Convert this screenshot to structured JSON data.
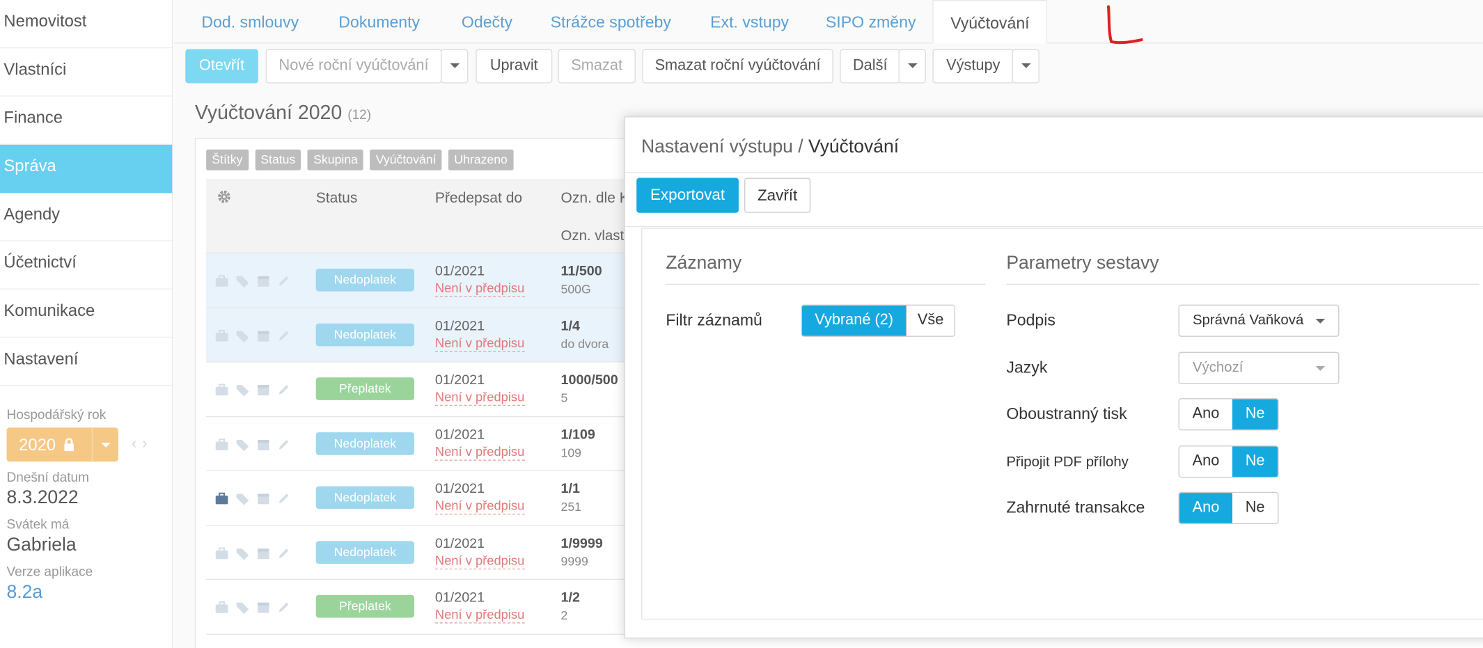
{
  "sidebar": {
    "items": [
      {
        "label": "Nemovitost",
        "active": false
      },
      {
        "label": "Vlastníci",
        "active": false
      },
      {
        "label": "Finance",
        "active": false
      },
      {
        "label": "Správa",
        "active": true
      },
      {
        "label": "Agendy",
        "active": false
      },
      {
        "label": "Účetnictví",
        "active": false
      },
      {
        "label": "Komunikace",
        "active": false
      },
      {
        "label": "Nastavení",
        "active": false
      }
    ],
    "fiscal_year_label": "Hospodářský rok",
    "fiscal_year": "2020",
    "today_label": "Dnešní datum",
    "today": "8.3.2022",
    "nameday_label": "Svátek má",
    "nameday": "Gabriela",
    "version_label": "Verze aplikace",
    "version": "8.2a"
  },
  "tabs": [
    "Dod. smlouvy",
    "Dokumenty",
    "Odečty",
    "Strážce spotřeby",
    "Ext. vstupy",
    "SIPO změny",
    "Vyúčtování"
  ],
  "active_tab": "Vyúčtování",
  "toolbar": {
    "open": "Otevřít",
    "new_annual": "Nové roční vyúčtování",
    "edit": "Upravit",
    "delete": "Smazat",
    "delete_annual": "Smazat roční vyúčtování",
    "more": "Další",
    "outputs": "Výstupy"
  },
  "page": {
    "title": "Vyúčtování 2020",
    "count": "(12)"
  },
  "filters": [
    "Štítky",
    "Status",
    "Skupina",
    "Vyúčtování",
    "Uhrazeno"
  ],
  "table": {
    "headers": {
      "status": "Status",
      "due": "Předepsat do",
      "code": "Ozn. dle K",
      "code2": "Ozn. vlast"
    },
    "rows": [
      {
        "status": "Nedoplatek",
        "due": "01/2021",
        "note": "Není v předpisu",
        "code": "11/500",
        "sub": "500G"
      },
      {
        "status": "Nedoplatek",
        "due": "01/2021",
        "note": "Není v předpisu",
        "code": "1/4",
        "sub": "do dvora"
      },
      {
        "status": "Přeplatek",
        "due": "01/2021",
        "note": "Není v předpisu",
        "code": "1000/500",
        "sub": "5"
      },
      {
        "status": "Nedoplatek",
        "due": "01/2021",
        "note": "Není v předpisu",
        "code": "1/109",
        "sub": "109"
      },
      {
        "status": "Nedoplatek",
        "due": "01/2021",
        "note": "Není v předpisu",
        "code": "1/1",
        "sub": "251"
      },
      {
        "status": "Nedoplatek",
        "due": "01/2021",
        "note": "Není v předpisu",
        "code": "1/9999",
        "sub": "9999"
      },
      {
        "status": "Přeplatek",
        "due": "01/2021",
        "note": "Není v předpisu",
        "code": "1/2",
        "sub": "2"
      }
    ]
  },
  "modal": {
    "title_prefix": "Nastavení výstupu /",
    "title": "Vyúčtování",
    "export": "Exportovat",
    "close": "Zavřít",
    "records_title": "Záznamy",
    "filter_label": "Filtr záznamů",
    "filter_selected": "Vybrané (2)",
    "filter_all": "Vše",
    "params_title": "Parametry sestavy",
    "signature_label": "Podpis",
    "signature_value": "Správná Vaňková",
    "language_label": "Jazyk",
    "language_value": "Výchozí",
    "duplex_label": "Oboustranný tisk",
    "attach_label": "Připojit PDF přílohy",
    "transactions_label": "Zahrnuté transakce",
    "yes": "Ano",
    "no": "Ne"
  },
  "colors": {
    "accent": "#15a9e0",
    "sidebar_active": "#67cfef",
    "badge_underpaid": "#9fd7ef",
    "badge_overpaid": "#9ad49b",
    "year": "#f6c886",
    "annotation": "#e02020"
  }
}
